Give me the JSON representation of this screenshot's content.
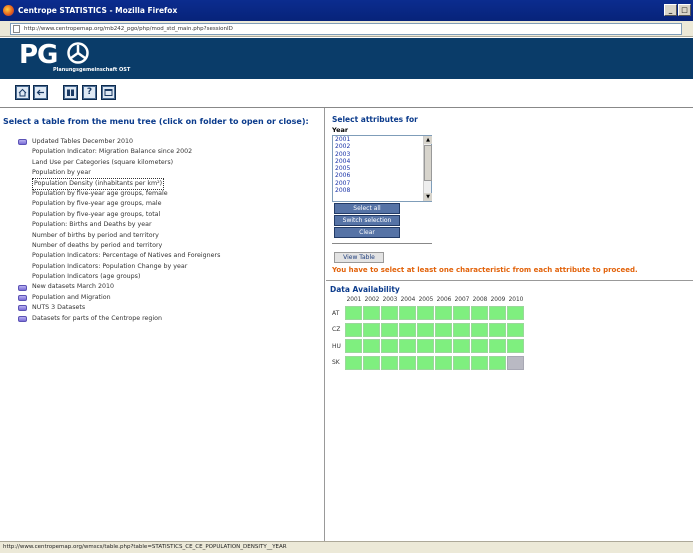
{
  "window": {
    "title": "Centrope STATISTICS - Mozilla Firefox",
    "url": "http://www.centropemap.org/mb242_pgo/php/mod_std_main.php?sessionID",
    "buttons": [
      "_",
      "□"
    ]
  },
  "banner": {
    "logo": "PG",
    "subtitle": "Planungsgemeinschaft OST"
  },
  "toolbar": {
    "icons": [
      "home-icon",
      "back-icon",
      "book-icon",
      "help-icon",
      "window-icon"
    ],
    "help_label": "?"
  },
  "left": {
    "title": "Select a table from the menu tree (click on folder to open or close):",
    "tree": [
      {
        "label": "Updated Tables December 2010",
        "folder": true,
        "child": false
      },
      {
        "label": "Population Indicator: Migration Balance since 2002",
        "folder": false,
        "child": true
      },
      {
        "label": "Land Use per Categories (square kilometers)",
        "folder": false,
        "child": true
      },
      {
        "label": "Population by year",
        "folder": false,
        "child": true
      },
      {
        "label": "Population Density (inhabitants per km²)",
        "folder": false,
        "child": true,
        "selected": true
      },
      {
        "label": "Population by five-year age groups, female",
        "folder": false,
        "child": true
      },
      {
        "label": "Population by five-year age groups, male",
        "folder": false,
        "child": true
      },
      {
        "label": "Population by five-year age groups, total",
        "folder": false,
        "child": true
      },
      {
        "label": "Population: Births and Deaths by year",
        "folder": false,
        "child": true
      },
      {
        "label": "Number of births by period and territory",
        "folder": false,
        "child": true
      },
      {
        "label": "Number of deaths by period and territory",
        "folder": false,
        "child": true
      },
      {
        "label": "Population Indicators: Percentage of Natives and Foreigners",
        "folder": false,
        "child": true
      },
      {
        "label": "Population Indicators: Population Change by year",
        "folder": false,
        "child": true
      },
      {
        "label": "Population Indicators (age groups)",
        "folder": false,
        "child": true
      },
      {
        "label": "New datasets March 2010",
        "folder": true,
        "child": false
      },
      {
        "label": "Population and Migration",
        "folder": true,
        "child": false
      },
      {
        "label": "NUTS 3 Datasets",
        "folder": true,
        "child": false
      },
      {
        "label": "Datasets for parts of the Centrope region",
        "folder": true,
        "child": false
      }
    ]
  },
  "right": {
    "title": "Select attributes for",
    "year_label": "Year",
    "years": [
      "2001",
      "2002",
      "2003",
      "2004",
      "2005",
      "2006",
      "2007",
      "2008"
    ],
    "buttons": {
      "select_all": "Select all",
      "switch": "Switch selection",
      "clear": "Clear",
      "view": "View Table"
    },
    "warning": "You have to select at least one characteristic from each attribute to proceed.",
    "availability": {
      "title": "Data Availability",
      "years": [
        "2001",
        "2002",
        "2003",
        "2004",
        "2005",
        "2006",
        "2007",
        "2008",
        "2009",
        "2010"
      ],
      "rows": [
        {
          "country": "AT",
          "available": [
            true,
            true,
            true,
            true,
            true,
            true,
            true,
            true,
            true,
            true
          ]
        },
        {
          "country": "CZ",
          "available": [
            true,
            true,
            true,
            true,
            true,
            true,
            true,
            true,
            true,
            true
          ]
        },
        {
          "country": "HU",
          "available": [
            true,
            true,
            true,
            true,
            true,
            true,
            true,
            true,
            true,
            true
          ]
        },
        {
          "country": "SK",
          "available": [
            true,
            true,
            true,
            true,
            true,
            true,
            true,
            true,
            true,
            false
          ]
        }
      ],
      "colors": {
        "available": "#7fef7f",
        "missing": "#b9b9c3"
      }
    }
  },
  "status": {
    "text": "http://www.centropemap.org/wmscs/table.php?table=STATISTICS_CE_CE_POPULATION_DENSITY__YEAR"
  }
}
